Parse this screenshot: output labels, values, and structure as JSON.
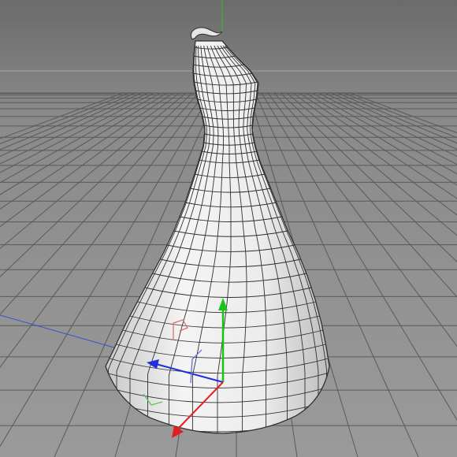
{
  "viewport": {
    "view": "perspective",
    "background_colors": [
      "#6b6b6b",
      "#8a8a8a",
      "#9a9a9a"
    ],
    "grid_color": "#5a5a5a",
    "horizon_color": "#a0a0a0"
  },
  "model": {
    "shape": "dress-form",
    "surface_color": "#f0f0f0",
    "wire_color": "#303030"
  },
  "gizmo": {
    "x_axis_color": "#e02020",
    "y_axis_color": "#19c419",
    "z_axis_color": "#2030e0"
  },
  "icons": [
    "move-gizmo-icon"
  ]
}
